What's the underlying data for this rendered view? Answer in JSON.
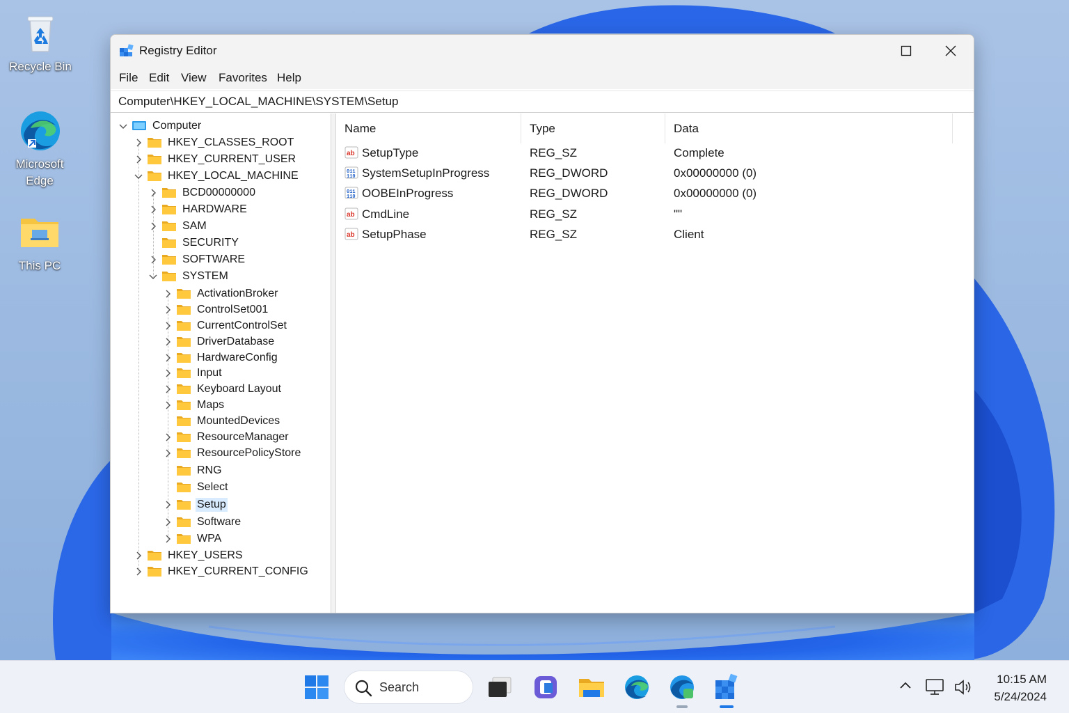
{
  "desktop": {
    "icons": [
      {
        "label": "Recycle Bin"
      },
      {
        "label": "Microsoft Edge"
      },
      {
        "label": "This PC"
      }
    ]
  },
  "window": {
    "title": "Registry Editor",
    "menu": [
      "File",
      "Edit",
      "View",
      "Favorites",
      "Help"
    ],
    "address": "Computer\\HKEY_LOCAL_MACHINE\\SYSTEM\\Setup"
  },
  "tree": [
    {
      "label": "Computer",
      "level": 0,
      "state": "expanded",
      "icon": "computer"
    },
    {
      "label": "HKEY_CLASSES_ROOT",
      "level": 1,
      "state": "collapsed"
    },
    {
      "label": "HKEY_CURRENT_USER",
      "level": 1,
      "state": "collapsed"
    },
    {
      "label": "HKEY_LOCAL_MACHINE",
      "level": 1,
      "state": "expanded"
    },
    {
      "label": "BCD00000000",
      "level": 2,
      "state": "collapsed"
    },
    {
      "label": "HARDWARE",
      "level": 2,
      "state": "collapsed"
    },
    {
      "label": "SAM",
      "level": 2,
      "state": "collapsed"
    },
    {
      "label": "SECURITY",
      "level": 2,
      "state": "leaf"
    },
    {
      "label": "SOFTWARE",
      "level": 2,
      "state": "collapsed"
    },
    {
      "label": "SYSTEM",
      "level": 2,
      "state": "expanded"
    },
    {
      "label": "ActivationBroker",
      "level": 3,
      "state": "collapsed"
    },
    {
      "label": "ControlSet001",
      "level": 3,
      "state": "collapsed"
    },
    {
      "label": "CurrentControlSet",
      "level": 3,
      "state": "collapsed"
    },
    {
      "label": "DriverDatabase",
      "level": 3,
      "state": "collapsed"
    },
    {
      "label": "HardwareConfig",
      "level": 3,
      "state": "collapsed"
    },
    {
      "label": "Input",
      "level": 3,
      "state": "collapsed"
    },
    {
      "label": "Keyboard Layout",
      "level": 3,
      "state": "collapsed"
    },
    {
      "label": "Maps",
      "level": 3,
      "state": "collapsed"
    },
    {
      "label": "MountedDevices",
      "level": 3,
      "state": "leaf"
    },
    {
      "label": "ResourceManager",
      "level": 3,
      "state": "collapsed"
    },
    {
      "label": "ResourcePolicyStore",
      "level": 3,
      "state": "collapsed"
    },
    {
      "label": "RNG",
      "level": 3,
      "state": "leaf"
    },
    {
      "label": "Select",
      "level": 3,
      "state": "leaf"
    },
    {
      "label": "Setup",
      "level": 3,
      "state": "collapsed",
      "selected": true
    },
    {
      "label": "Software",
      "level": 3,
      "state": "collapsed"
    },
    {
      "label": "WPA",
      "level": 3,
      "state": "collapsed"
    },
    {
      "label": "HKEY_USERS",
      "level": 1,
      "state": "collapsed"
    },
    {
      "label": "HKEY_CURRENT_CONFIG",
      "level": 1,
      "state": "collapsed"
    }
  ],
  "list": {
    "columns": [
      "Name",
      "Type",
      "Data"
    ],
    "rows": [
      {
        "name": "SetupType",
        "type": "REG_SZ",
        "data": "Complete",
        "icon": "string-value-icon"
      },
      {
        "name": "SystemSetupInProgress",
        "type": "REG_DWORD",
        "data": "0x00000000 (0)",
        "icon": "binary-value-icon"
      },
      {
        "name": "OOBEInProgress",
        "type": "REG_DWORD",
        "data": "0x00000000 (0)",
        "icon": "binary-value-icon"
      },
      {
        "name": "CmdLine",
        "type": "REG_SZ",
        "data": "\"\"",
        "icon": "string-value-icon"
      },
      {
        "name": "SetupPhase",
        "type": "REG_SZ",
        "data": "Client",
        "icon": "string-value-icon"
      }
    ]
  },
  "taskbar": {
    "search_label": "Search",
    "time": "10:15 AM",
    "date": "5/24/2024"
  }
}
